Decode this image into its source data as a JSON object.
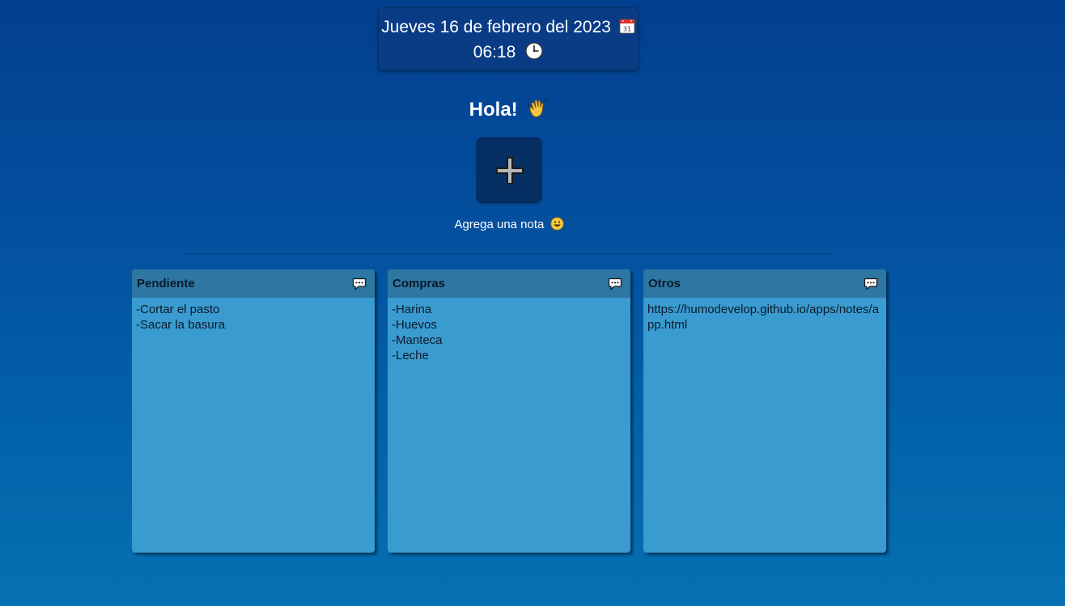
{
  "header": {
    "date": "Jueves 16 de febrero del 2023",
    "time": "06:18",
    "calendar_icon": "calendar-icon",
    "clock_icon": "clock-icon"
  },
  "greeting": {
    "text": "Hola!",
    "icon": "waving-hand-icon"
  },
  "add_note": {
    "icon": "plus-icon",
    "label": "Agrega una nota",
    "label_icon": "smiley-icon"
  },
  "notes": [
    {
      "title": "Pendiente",
      "icon": "speech-bubble-icon",
      "lines": [
        "-Cortar el pasto",
        "-Sacar la basura"
      ]
    },
    {
      "title": "Compras",
      "icon": "speech-bubble-icon",
      "lines": [
        "-Harina",
        "-Huevos",
        "-Manteca",
        "-Leche"
      ]
    },
    {
      "title": "Otros",
      "icon": "speech-bubble-icon",
      "lines": [
        "https://humodevelop.github.io/apps/notes/app.html"
      ]
    }
  ],
  "colors": {
    "background_top": "#033f8f",
    "background_bottom": "#0670b2",
    "card": "#0a3c86",
    "add_button": "#062f63",
    "note_body": "#3a9bd0",
    "note_header": "#2e77a3",
    "text_dark": "#0a1a2a",
    "text_light": "#ffffff"
  }
}
